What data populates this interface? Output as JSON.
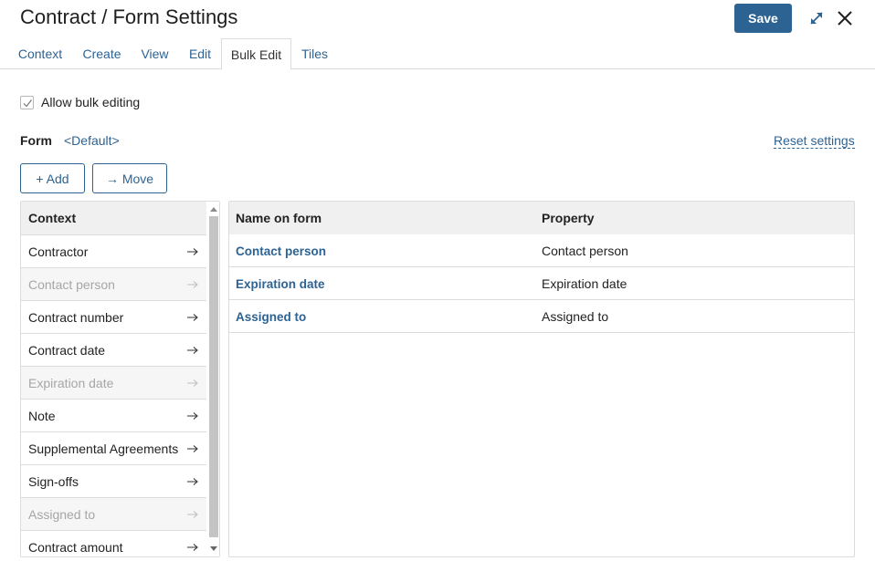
{
  "header": {
    "title": "Contract / Form Settings",
    "save_label": "Save"
  },
  "tabs": [
    {
      "label": "Context",
      "active": false
    },
    {
      "label": "Create",
      "active": false
    },
    {
      "label": "View",
      "active": false
    },
    {
      "label": "Edit",
      "active": false
    },
    {
      "label": "Bulk Edit",
      "active": true
    },
    {
      "label": "Tiles",
      "active": false
    }
  ],
  "settings": {
    "allow_bulk_label": "Allow bulk editing",
    "allow_bulk_checked": true,
    "form_label": "Form",
    "form_value": "<Default>",
    "reset_label": "Reset settings"
  },
  "toolbar": {
    "add_label": "+ Add",
    "move_label": "→ Move"
  },
  "context_list": {
    "header": "Context",
    "items": [
      {
        "label": "Contractor",
        "disabled": false
      },
      {
        "label": "Contact person",
        "disabled": true
      },
      {
        "label": "Contract number",
        "disabled": false
      },
      {
        "label": "Contract date",
        "disabled": false
      },
      {
        "label": "Expiration date",
        "disabled": true
      },
      {
        "label": "Note",
        "disabled": false
      },
      {
        "label": "Supplemental Agreements",
        "disabled": false
      },
      {
        "label": "Sign-offs",
        "disabled": false
      },
      {
        "label": "Assigned to",
        "disabled": true
      },
      {
        "label": "Contract amount",
        "disabled": false
      }
    ]
  },
  "form_table": {
    "columns": [
      "Name on form",
      "Property"
    ],
    "rows": [
      {
        "name": "Contact person",
        "property": "Contact person"
      },
      {
        "name": "Expiration date",
        "property": "Expiration date"
      },
      {
        "name": "Assigned to",
        "property": "Assigned to"
      }
    ]
  },
  "colors": {
    "accent": "#2d6393",
    "header_bg": "#f0f0f0",
    "disabled_text": "#a6a6a6"
  },
  "icons": {
    "expand": "expand-icon",
    "close": "close-icon",
    "checkmark": "checkmark-icon",
    "row_arrow": "arrow-right-icon",
    "scroll_up": "scroll-up-arrow-icon",
    "scroll_down": "scroll-down-arrow-icon"
  }
}
